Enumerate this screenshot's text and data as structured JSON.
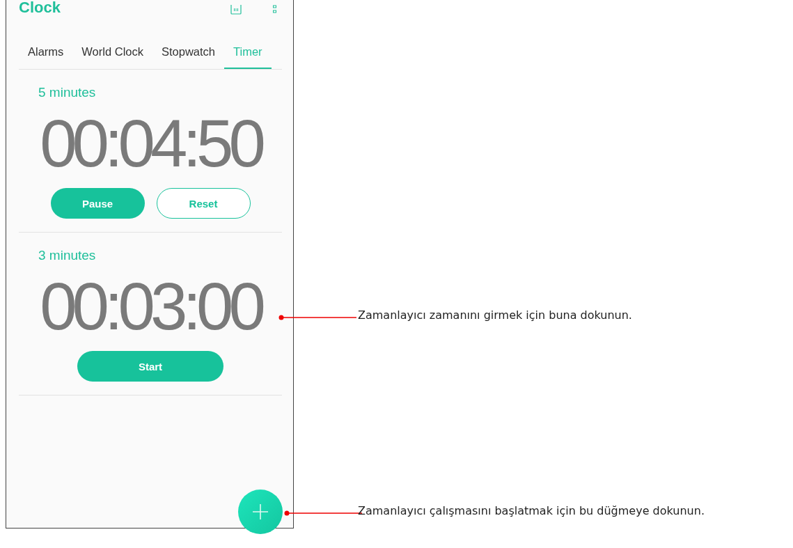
{
  "app": {
    "title": "Clock"
  },
  "tabs": [
    {
      "label": "Alarms",
      "selected": false
    },
    {
      "label": "World Clock",
      "selected": false
    },
    {
      "label": "Stopwatch",
      "selected": false
    },
    {
      "label": "Timer",
      "selected": true
    }
  ],
  "timers": [
    {
      "label": "5 minutes",
      "time": "00:04:50",
      "buttons": [
        {
          "label": "Pause",
          "kind": "filled"
        },
        {
          "label": "Reset",
          "kind": "outline"
        }
      ]
    },
    {
      "label": "3 minutes",
      "time": "00:03:00",
      "buttons": [
        {
          "label": "Start",
          "kind": "wide"
        }
      ]
    }
  ],
  "callouts": [
    {
      "text": "Zamanlayıcı zamanını girmek için buna dokunun."
    },
    {
      "text": "Zamanlayıcı çalışmasını başlatmak için bu düğmeye dokunun."
    }
  ]
}
